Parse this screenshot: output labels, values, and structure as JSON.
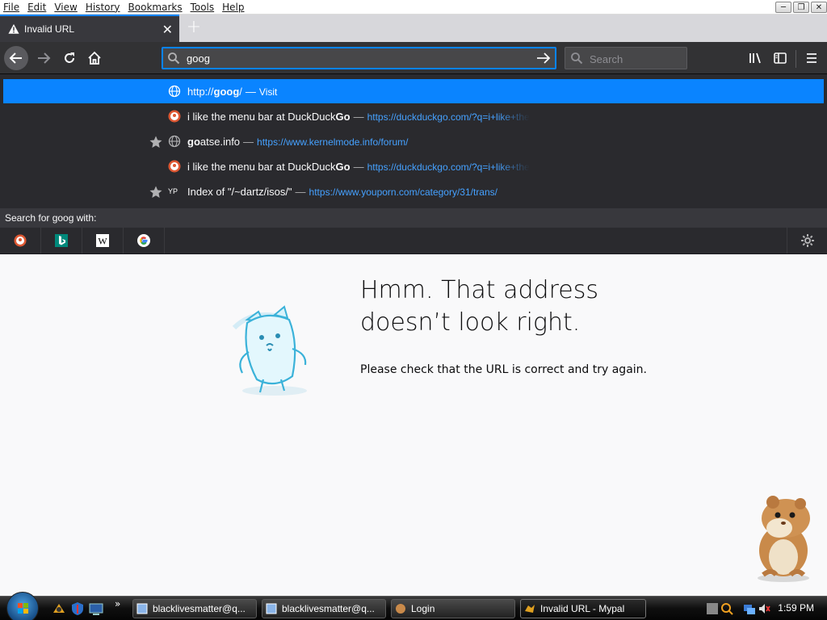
{
  "menubar": {
    "items": [
      "File",
      "Edit",
      "View",
      "History",
      "Bookmarks",
      "Tools",
      "Help"
    ]
  },
  "tab": {
    "title": "Invalid URL"
  },
  "urlbar": {
    "value": "goog"
  },
  "searchbar": {
    "placeholder": "Search"
  },
  "dropdown": {
    "rows": [
      {
        "pre": "http://",
        "bold": "goog",
        "post": "/",
        "dash": "—",
        "action": "Visit"
      },
      {
        "title_pre": "i like the menu bar at DuckDuck",
        "title_bold": "Go",
        "dash": "—",
        "url": "https://duckduckgo.com/?q=i+like+the"
      },
      {
        "title_bold": "go",
        "title_post": "atse.info",
        "dash": "—",
        "url": "https://www.kernelmode.info/forum/"
      },
      {
        "title_pre": "i like the menu bar at DuckDuck",
        "title_bold": "Go",
        "dash": "—",
        "url": "https://duckduckgo.com/?q=i+like+the"
      },
      {
        "title": "Index of \"/~dartz/isos/\"",
        "dash": "—",
        "url": "https://www.youporn.com/category/31/trans/",
        "fav": "YP"
      }
    ],
    "search_with": "Search for goog with:",
    "engines": [
      "duckduckgo-icon",
      "bing-icon",
      "wikipedia-icon",
      "google-icon"
    ]
  },
  "error": {
    "title": "Hmm. That address doesn’t look right.",
    "text": "Please check that the URL is correct and try again."
  },
  "taskbar": {
    "buttons": [
      "blacklivesmatter@q...",
      "blacklivesmatter@q...",
      "Login",
      "Invalid URL - Mypal"
    ],
    "clock": "1:59 PM",
    "chevron": "»"
  }
}
